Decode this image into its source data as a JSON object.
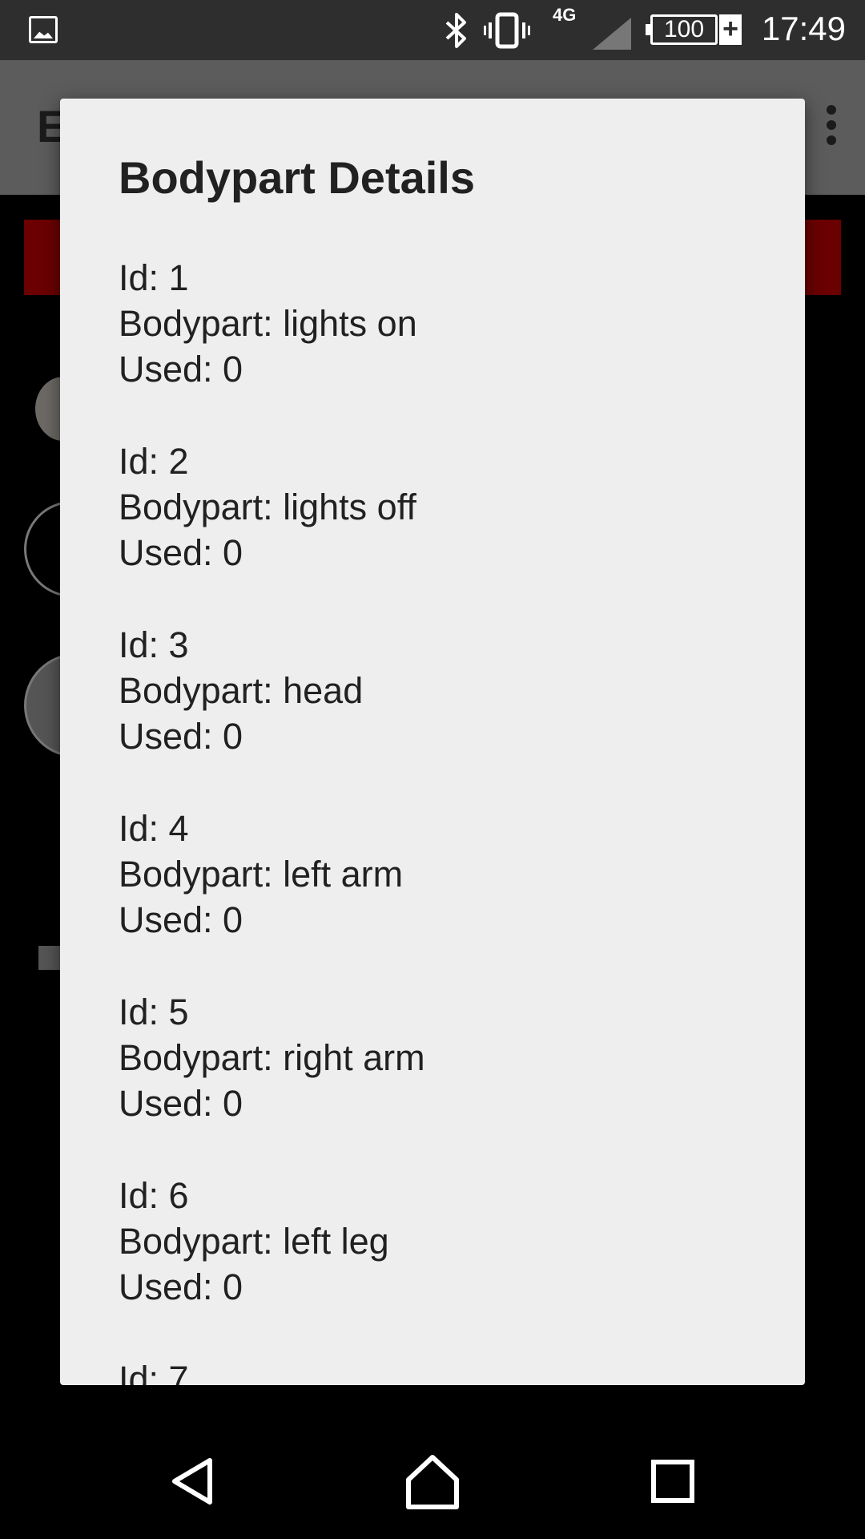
{
  "status_bar": {
    "network_label": "4G",
    "battery": "100",
    "charge_symbol": "+",
    "time": "17:49"
  },
  "background_app": {
    "title_partial": "E"
  },
  "dialog": {
    "title": "Bodypart Details",
    "items": [
      {
        "id": "Id: 1",
        "bodypart": "Bodypart: lights on",
        "used": "Used: 0"
      },
      {
        "id": "Id: 2",
        "bodypart": "Bodypart: lights off",
        "used": "Used: 0"
      },
      {
        "id": "Id: 3",
        "bodypart": "Bodypart: head",
        "used": "Used: 0"
      },
      {
        "id": "Id: 4",
        "bodypart": "Bodypart: left arm",
        "used": "Used: 0"
      },
      {
        "id": "Id: 5",
        "bodypart": "Bodypart: right arm",
        "used": "Used: 0"
      },
      {
        "id": "Id: 6",
        "bodypart": "Bodypart: left leg",
        "used": "Used: 0"
      },
      {
        "id": "Id: 7",
        "bodypart": "",
        "used": ""
      }
    ]
  },
  "nav_bar": {
    "back_icon": "back-triangle-icon",
    "home_icon": "home-icon",
    "recents_icon": "recents-square-icon"
  },
  "colors": {
    "status_bar": "#2e2e2e",
    "dialog_bg": "#eeeeee",
    "banner_red": "#6b0000"
  }
}
